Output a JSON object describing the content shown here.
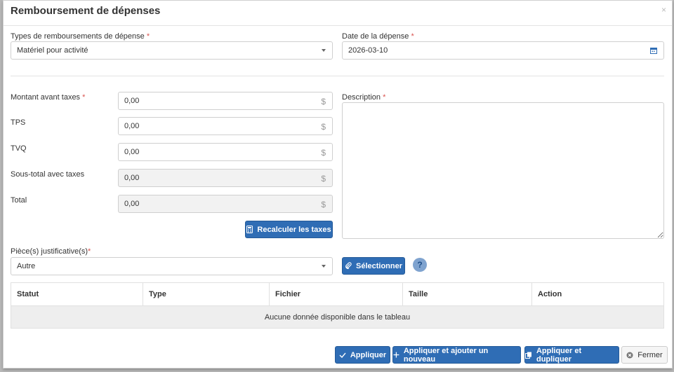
{
  "modal": {
    "title": "Remboursement de dépenses",
    "close_glyph": "×"
  },
  "form": {
    "type_label": "Types de remboursements de dépense",
    "type_value": "Matériel pour activité",
    "date_label": "Date de la dépense",
    "date_value": "2026-03-10",
    "montant_label": "Montant avant taxes",
    "montant_value": "0,00",
    "tps_label": "TPS",
    "tps_value": "0,00",
    "tvq_label": "TVQ",
    "tvq_value": "0,00",
    "soustotal_label": "Sous-total avec taxes",
    "soustotal_value": "0,00",
    "total_label": "Total",
    "total_value": "0,00",
    "currency_symbol": "$",
    "required_mark": "*",
    "description_label": "Description",
    "recalc_label": "Recalculer les taxes",
    "pieces_label": "Pièce(s) justificative(s)",
    "pieces_value": "Autre",
    "select_label": "Sélectionner",
    "help_glyph": "?"
  },
  "table": {
    "columns": [
      "Statut",
      "Type",
      "Fichier",
      "Taille",
      "Action"
    ],
    "empty_message": "Aucune donnée disponible dans le tableau"
  },
  "footer": {
    "apply_label": "Appliquer",
    "apply_new_label": "Appliquer et ajouter un nouveau",
    "apply_dup_label": "Appliquer et dupliquer",
    "close_label": "Fermer"
  },
  "colors": {
    "primary": "#2f6db5",
    "required": "#d9534f",
    "help": "#7fa3cf"
  }
}
